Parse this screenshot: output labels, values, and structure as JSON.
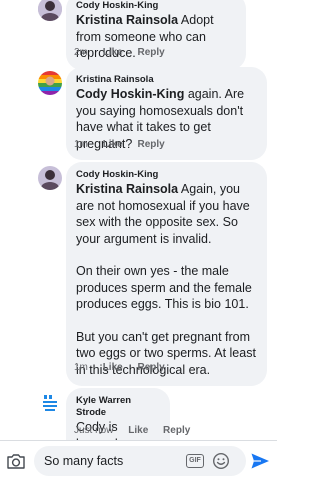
{
  "comments": [
    {
      "author": "Cody Hoskin-King",
      "mention": "Kristina Rainsola",
      "paragraphs": [
        "Adopt from someone who can reproduce."
      ],
      "time": "2m",
      "like": "Like",
      "reply": "Reply"
    },
    {
      "author": "Kristina Rainsola",
      "mention": "Cody Hoskin-King",
      "paragraphs": [
        "again. Are you saying homosexuals don't have what it takes to get pregnant?"
      ],
      "time": "1m",
      "like": "Like",
      "reply": "Reply"
    },
    {
      "author": "Cody Hoskin-King",
      "mention": "Kristina Rainsola",
      "paragraphs": [
        "Again, you are not homosexual if you have sex with the opposite sex.  So your argument is invalid.",
        "On their own yes - the male produces sperm and the female produces eggs. This is bio 101.",
        "But you can't get pregnant from two eggs or two sperms. At least in this technological era."
      ],
      "time": "1m",
      "like": "Like",
      "reply": "Reply"
    },
    {
      "author": "Kyle Warren Strode",
      "paragraphs": [
        "Cody is banned."
      ],
      "time": "Just now",
      "like": "Like",
      "reply": "Reply"
    }
  ],
  "composer": {
    "text": "So many facts",
    "gif_label": "GIF",
    "accent": "#1877f2"
  },
  "icons": [
    "camera-icon",
    "gif-icon",
    "emoji-icon",
    "send-icon"
  ]
}
